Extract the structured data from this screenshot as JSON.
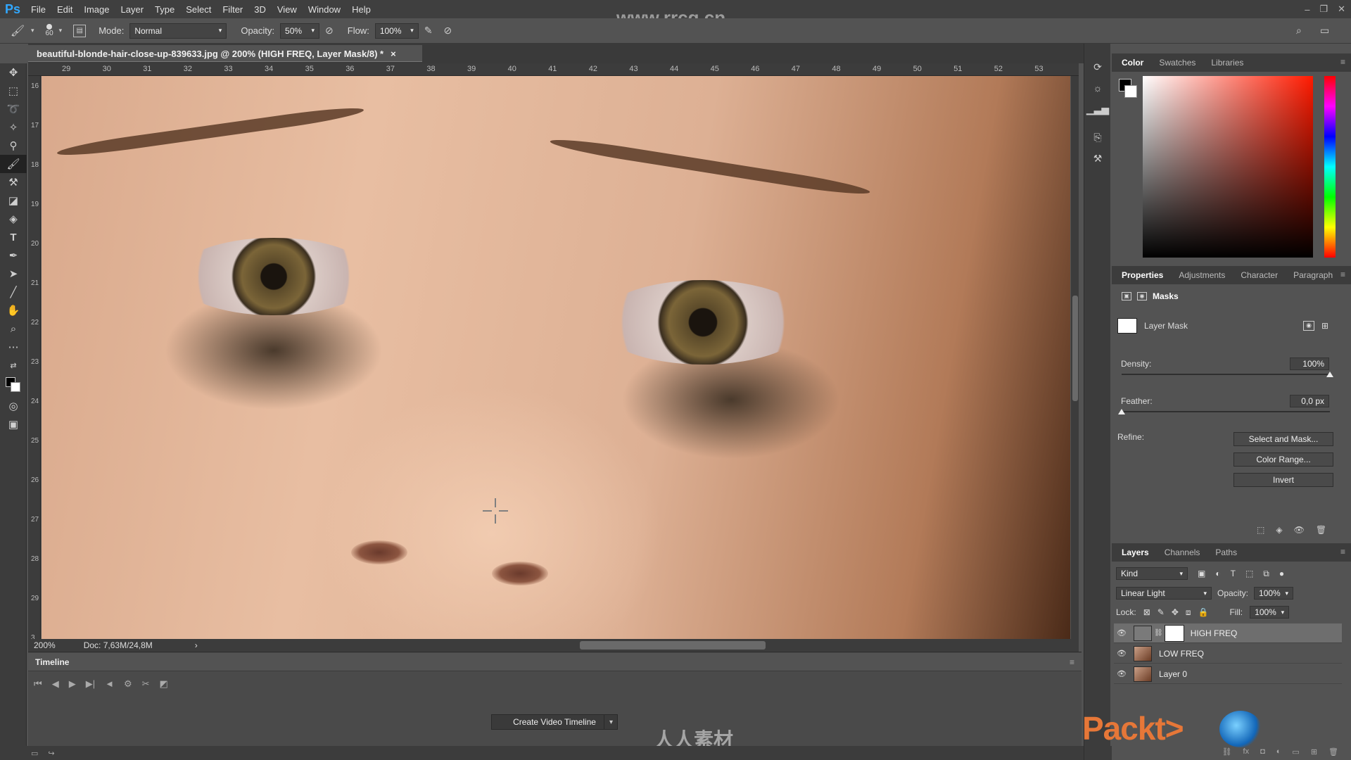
{
  "menubar": {
    "app_logo": "Ps",
    "items": [
      "File",
      "Edit",
      "Image",
      "Layer",
      "Type",
      "Select",
      "Filter",
      "3D",
      "View",
      "Window",
      "Help"
    ]
  },
  "watermark": "www.rrcg.cn",
  "options": {
    "brush_size": "60",
    "mode_label": "Mode:",
    "mode_value": "Normal",
    "opacity_label": "Opacity:",
    "opacity_value": "50%",
    "flow_label": "Flow:",
    "flow_value": "100%"
  },
  "document": {
    "tab_title": "beautiful-blonde-hair-close-up-839633.jpg @ 200% (HIGH FREQ, Layer Mask/8) *",
    "close": "×",
    "ruler_top": [
      "29",
      "30",
      "31",
      "32",
      "33",
      "34",
      "35",
      "36",
      "37",
      "38",
      "39",
      "40",
      "41",
      "42",
      "43",
      "44",
      "45",
      "46",
      "47",
      "48",
      "49",
      "50",
      "51",
      "52",
      "53"
    ],
    "ruler_left": [
      "16",
      "17",
      "18",
      "19",
      "20",
      "21",
      "22",
      "23",
      "24",
      "25",
      "26",
      "27",
      "28",
      "29",
      "3"
    ],
    "zoom": "200%",
    "doc_size": "Doc: 7,63M/24,8M"
  },
  "timeline": {
    "title": "Timeline",
    "create_button": "Create Video Timeline"
  },
  "color_panel": {
    "tabs": [
      "Color",
      "Swatches",
      "Libraries"
    ]
  },
  "properties_panel": {
    "tabs": [
      "Properties",
      "Adjustments",
      "Character",
      "Paragraph"
    ],
    "section": "Masks",
    "mask_name": "Layer Mask",
    "density_label": "Density:",
    "density_value": "100%",
    "density_level": 1.0,
    "feather_label": "Feather:",
    "feather_value": "0,0 px",
    "feather_level": 0.0,
    "refine_label": "Refine:",
    "buttons": [
      "Select and Mask...",
      "Color Range...",
      "Invert"
    ]
  },
  "layers_panel": {
    "tabs": [
      "Layers",
      "Channels",
      "Paths"
    ],
    "kind_label": "Kind",
    "blend_mode": "Linear Light",
    "opacity_label": "Opacity:",
    "opacity_value": "100%",
    "lock_label": "Lock:",
    "fill_label": "Fill:",
    "fill_value": "100%",
    "layers": [
      {
        "name": "HIGH FREQ",
        "active": true
      },
      {
        "name": "LOW FREQ",
        "active": false
      },
      {
        "name": "Layer 0",
        "active": false
      }
    ]
  },
  "branding": {
    "packt": "Packt>",
    "chinese_logo": "人人素材"
  },
  "colors": {
    "ps_blue": "#31a8ff",
    "packt_orange": "#e67738",
    "panel_bg": "#535353",
    "dark_bg": "#3c3c3c"
  }
}
